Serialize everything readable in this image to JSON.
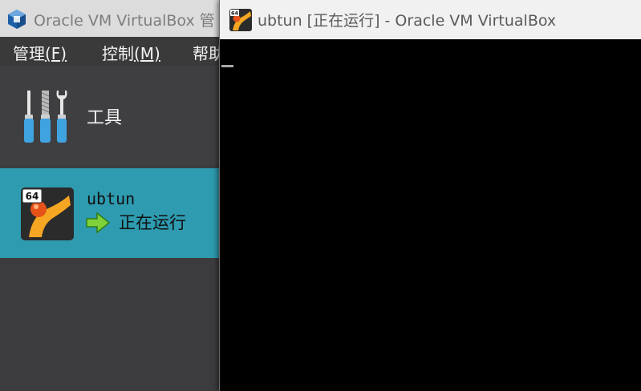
{
  "manager": {
    "title": "Oracle VM VirtualBox 管",
    "menu": [
      {
        "label": "管理",
        "accel": "(F)"
      },
      {
        "label": "控制",
        "accel": "(M)"
      },
      {
        "label": "帮助",
        "accel": ""
      }
    ],
    "tools_label": "工具",
    "vm": {
      "name": "ubtun",
      "state": "正在运行",
      "badge": "64"
    }
  },
  "vm_window": {
    "title": "ubtun [正在运行] - Oracle VM VirtualBox",
    "badge": "64"
  },
  "colors": {
    "selection": "#2e9bb0",
    "background": "#3c3c3e",
    "screen": "#000000"
  }
}
